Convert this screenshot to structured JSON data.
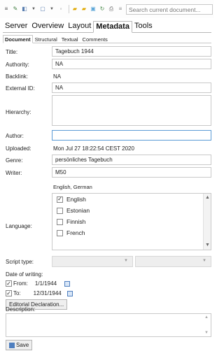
{
  "toolbar": {
    "search_placeholder": "Search current document..."
  },
  "main_tabs": [
    "Server",
    "Overview",
    "Layout",
    "Metadata",
    "Tools"
  ],
  "sub_tabs": [
    "Document",
    "Structural",
    "Textual",
    "Comments"
  ],
  "fields": {
    "title_label": "Title:",
    "title_value": "Tagebuch 1944",
    "authority_label": "Authority:",
    "authority_value": "NA",
    "backlink_label": "Backlink:",
    "backlink_value": "NA",
    "external_id_label": "External ID:",
    "external_id_value": "NA",
    "hierarchy_label": "Hierarchy:",
    "author_label": "Author:",
    "uploaded_label": "Uploaded:",
    "uploaded_value": "Mon Jul 27 18:22:54 CEST 2020",
    "genre_label": "Genre:",
    "genre_value": "persönliches Tagebuch",
    "writer_label": "Writer:",
    "writer_value": "M50"
  },
  "language": {
    "label": "Language:",
    "summary": "English, German",
    "options": [
      {
        "name": "English",
        "checked": true
      },
      {
        "name": "Estonian",
        "checked": false
      },
      {
        "name": "Finnish",
        "checked": false
      },
      {
        "name": "French",
        "checked": false
      }
    ]
  },
  "script_type_label": "Script type:",
  "date_of_writing": {
    "label": "Date of writing:",
    "from_label": "From:",
    "from_value": "1/1/1944",
    "to_label": "To:",
    "to_value": "12/31/1944"
  },
  "editorial_button": "Editorial Declaration...",
  "description_label": "Description:",
  "save_button": "Save",
  "colors": {
    "accent": "#5b9bd5",
    "save_icon": "#4f7fbf"
  }
}
